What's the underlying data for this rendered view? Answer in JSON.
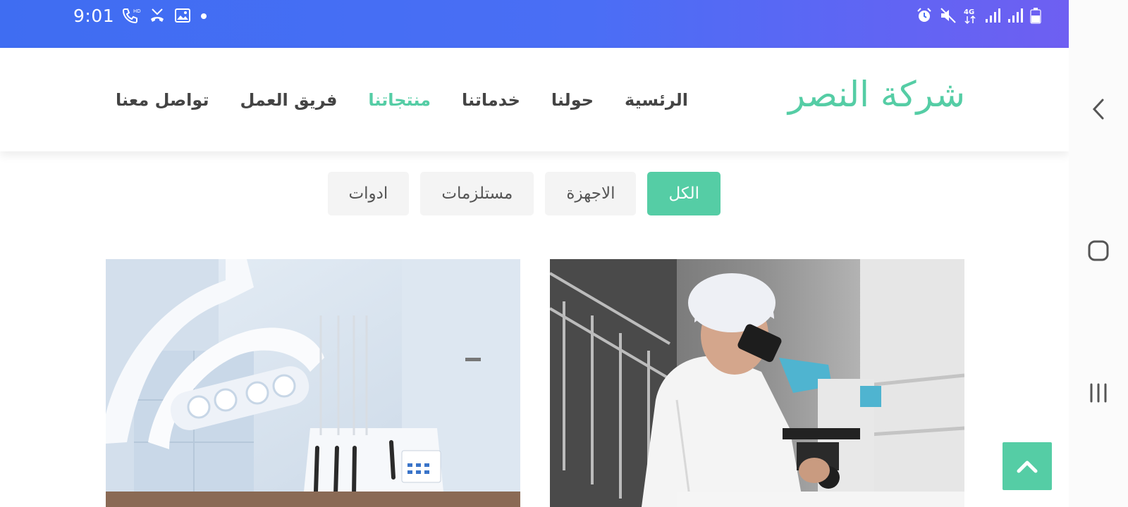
{
  "status_bar": {
    "time": "9:01",
    "left_icons": [
      "call-hd-icon",
      "missed-call-icon",
      "image-icon",
      "dot-icon"
    ],
    "right_icons": [
      "alarm-icon",
      "mute-icon",
      "network-4g-icon",
      "signal-icon",
      "signal-icon",
      "battery-icon"
    ],
    "network_label": "4G"
  },
  "header": {
    "logo": "شركة النصر",
    "nav": [
      {
        "label": "الرئسية",
        "active": false
      },
      {
        "label": "حولنا",
        "active": false
      },
      {
        "label": "خدماتنا",
        "active": false
      },
      {
        "label": "منتجاتنا",
        "active": true
      },
      {
        "label": "فريق العمل",
        "active": false
      },
      {
        "label": "تواصل معنا",
        "active": false
      }
    ]
  },
  "filters": [
    {
      "label": "الكل",
      "active": true
    },
    {
      "label": "الاجهزة",
      "active": false
    },
    {
      "label": "مستلزمات",
      "active": false
    },
    {
      "label": "ادوات",
      "active": false
    }
  ],
  "products": [
    {
      "image": "scientist-microscope-photo"
    },
    {
      "image": "dental-chair-photo"
    }
  ],
  "android_nav": [
    "back-icon",
    "home-icon",
    "recents-icon"
  ],
  "colors": {
    "accent": "#55cda5",
    "status_bar_start": "#3f6df2",
    "status_bar_end": "#6e5ff2",
    "nav_text": "#444444",
    "filter_bg": "#f4f4f4"
  }
}
